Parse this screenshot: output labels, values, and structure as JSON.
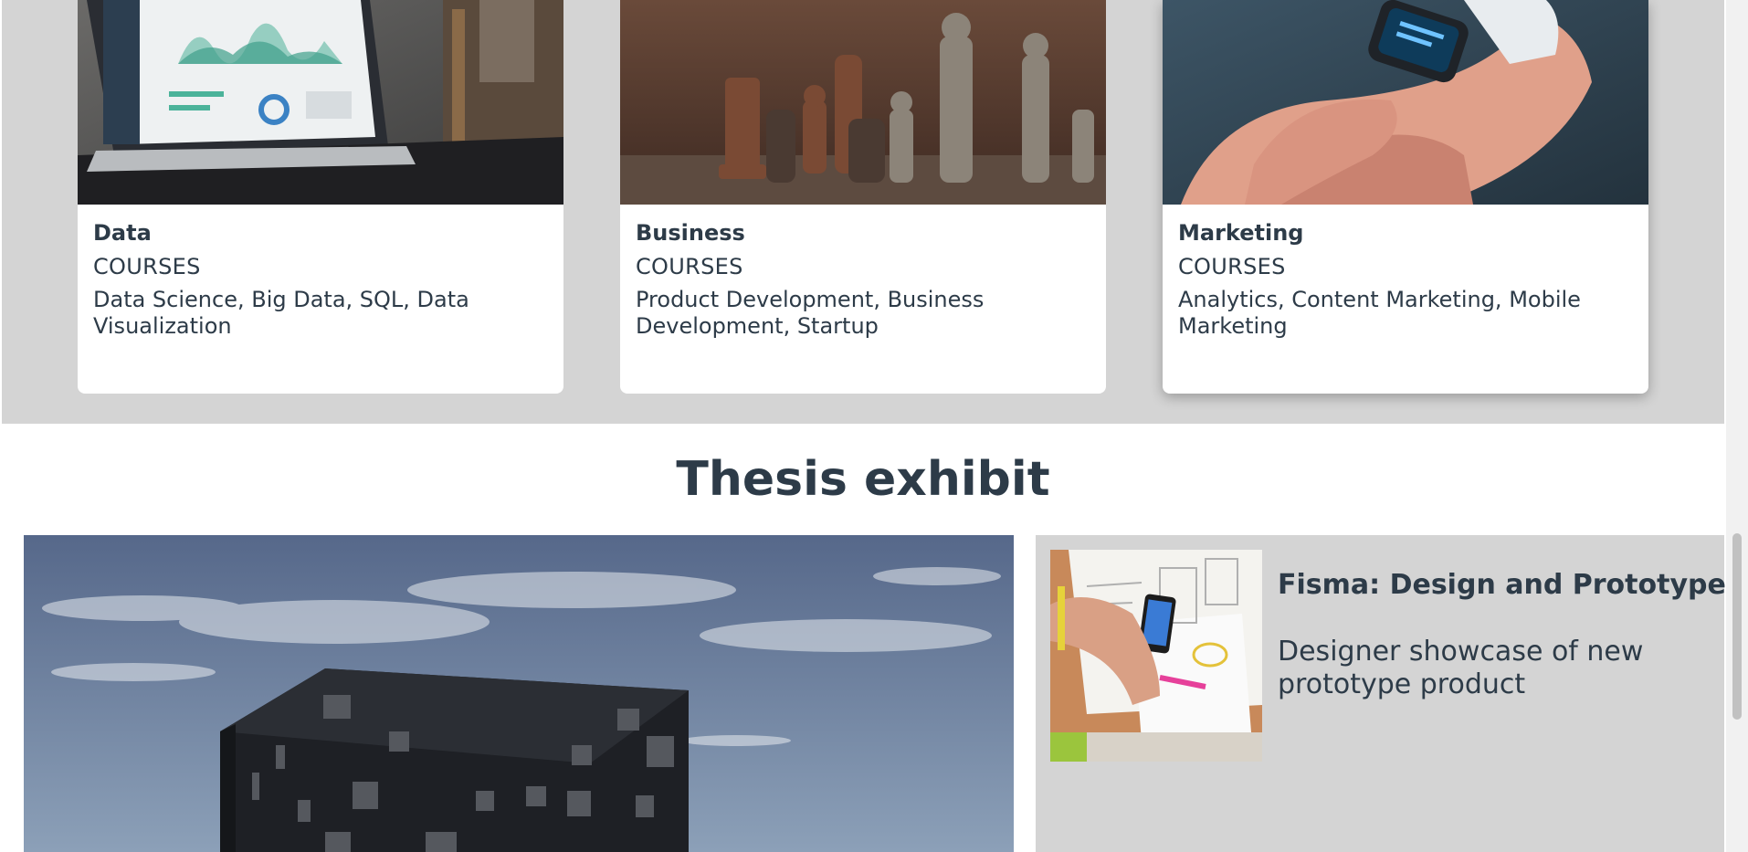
{
  "courses": [
    {
      "title": "Data",
      "kind": "COURSES",
      "topics": "Data Science, Big Data, SQL, Data Visualization",
      "image": "laptop-dashboard-photo"
    },
    {
      "title": "Business",
      "kind": "COURSES",
      "topics": "Product Development, Business Development, Startup",
      "image": "chess-pieces-photo"
    },
    {
      "title": "Marketing",
      "kind": "COURSES",
      "topics": "Analytics, Content Marketing, Mobile Marketing",
      "image": "smartwatch-photo"
    }
  ],
  "exhibit": {
    "heading": "Thesis exhibit",
    "main_image": "dark-cube-building-photo",
    "side": {
      "title": "Fisma: Design and Prototype",
      "description": "Designer showcase of new prototype product",
      "image": "designer-sketches-phone-photo"
    }
  },
  "colors": {
    "band": "#d4d4d4",
    "text": "#2d3b48",
    "card": "#ffffff"
  }
}
